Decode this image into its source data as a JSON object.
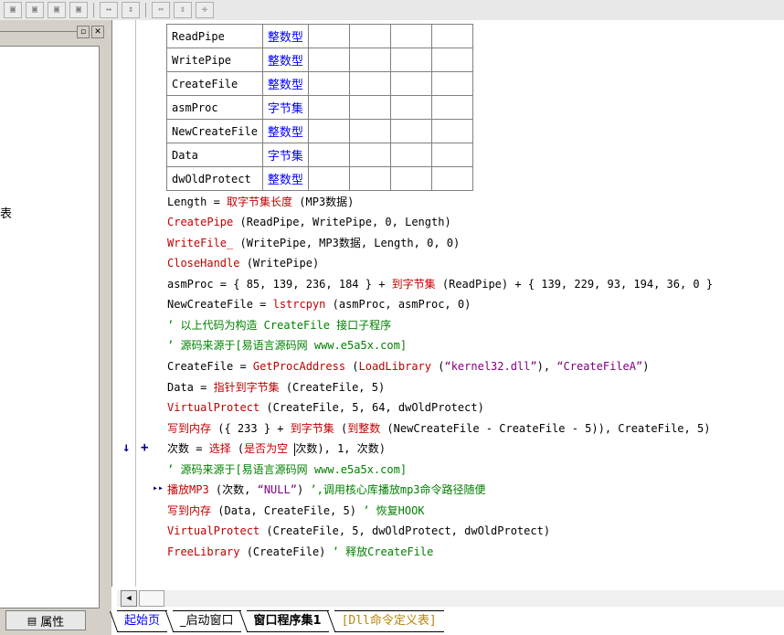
{
  "toolbar": {
    "icons": [
      "align-left-icon",
      "align-center-icon",
      "align-right-icon",
      "align-justify-icon",
      "width-icon",
      "height-icon",
      "same-width-icon",
      "same-height-icon",
      "center-icon"
    ]
  },
  "left_panel": {
    "fragment_text": "表",
    "properties_tab": "属性"
  },
  "var_table": {
    "rows": [
      {
        "name": "ReadPipe",
        "type": "整数型"
      },
      {
        "name": "WritePipe",
        "type": "整数型"
      },
      {
        "name": "CreateFile",
        "type": "整数型"
      },
      {
        "name": "asmProc",
        "type": "字节集"
      },
      {
        "name": "NewCreateFile",
        "type": "整数型"
      },
      {
        "name": "Data",
        "type": "字节集"
      },
      {
        "name": "dwOldProtect",
        "type": "整数型"
      }
    ]
  },
  "code": {
    "l1": {
      "a": "Length = ",
      "b": "取字节集长度",
      "c": " (MP3数据)"
    },
    "l2": {
      "a": "CreatePipe",
      "b": " (ReadPipe, WritePipe, 0, Length)"
    },
    "l3": {
      "a": "WriteFile_",
      "b": " (WritePipe, MP3数据, Length, 0, 0)"
    },
    "l4": {
      "a": "CloseHandle",
      "b": " (WritePipe)"
    },
    "l5": {
      "a": "asmProc = { 85, 139, 236, 184 } + ",
      "b": "到字节集",
      "c": " (ReadPipe) + { 139, 229, 93, 194, 36, 0 }"
    },
    "l6": {
      "a": "NewCreateFile = ",
      "b": "lstrcpyn",
      "c": " (asmProc, asmProc, 0)"
    },
    "l7": {
      "a": "’ 以上代码为构造 CreateFile 接口子程序"
    },
    "l8": {
      "a": "’ 源码来源于[易语言源码网 www.e5a5x.com]"
    },
    "l9": {
      "a": "CreateFile = ",
      "b": "GetProcAddress",
      "c": " (",
      "d": "LoadLibrary",
      "e": " (",
      "f": "“kernel32.dll”",
      "g": "), ",
      "h": "“CreateFileA”",
      "i": ")"
    },
    "l10": {
      "a": "Data = ",
      "b": "指针到字节集",
      "c": " (CreateFile, 5)"
    },
    "l11": {
      "a": "VirtualProtect",
      "b": " (CreateFile, 5, 64, dwOldProtect)"
    },
    "l12": {
      "a": "写到内存",
      "b": " ({ 233 } + ",
      "c": "到字节集",
      "d": " (",
      "e": "到整数",
      "f": " (NewCreateFile - CreateFile - 5)), CreateFile, 5)"
    },
    "l13": {
      "a": "次数 = ",
      "b": "选择",
      "c": " (",
      "d": "是否为空",
      "e": "次数), 1, 次数)"
    },
    "l14": {
      "a": "’ 源码来源于[易语言源码网 www.e5a5x.com]"
    },
    "l15": {
      "a": "播放MP3",
      "b": " (次数, ",
      "c": "“NULL”",
      "d": ") ",
      "e": "’,调用核心库播放mp3命令路径随便"
    },
    "l16": {
      "a": "写到内存",
      "b": " (Data, CreateFile, 5) ",
      "c": "’ 恢复HOOK"
    },
    "l17": {
      "a": "VirtualProtect",
      "b": " (CreateFile, 5, dwOldProtect, dwOldProtect)"
    },
    "l18": {
      "a": "FreeLibrary",
      "b": " (CreateFile) ",
      "c": "’ 释放CreateFile"
    }
  },
  "markers": {
    "arrow_down": "↓",
    "plus": "+",
    "play": "▸▸"
  },
  "tabs": [
    "起始页",
    "_启动窗口",
    "窗口程序集1",
    "[Dll命令定义表]"
  ]
}
